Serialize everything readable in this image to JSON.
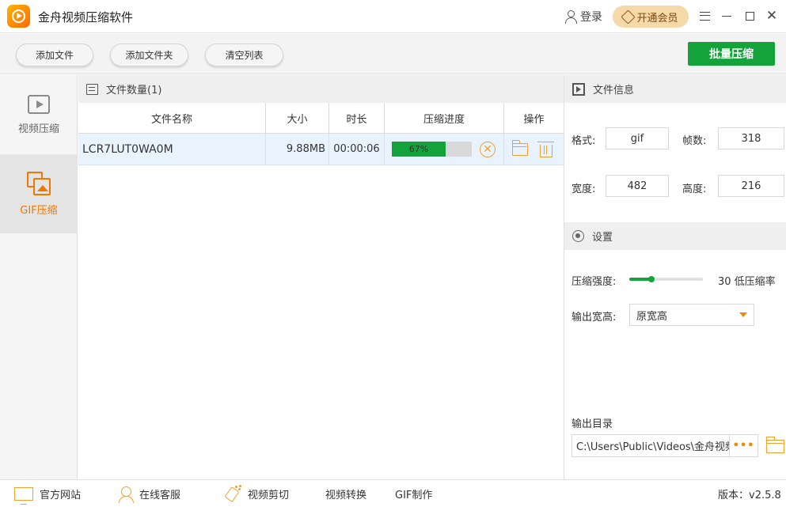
{
  "app": {
    "title": "金舟视频压缩软件"
  },
  "titlebar": {
    "login_label": "登录",
    "vip_label": "开通会员"
  },
  "toolbar": {
    "add_file": "添加文件",
    "add_folder": "添加文件夹",
    "clear_list": "清空列表",
    "batch_compress": "批量压缩"
  },
  "nav": {
    "items": [
      {
        "label": "视频压缩",
        "icon": "video-play-icon",
        "active": false
      },
      {
        "label": "GIF压缩",
        "icon": "gif-image-icon",
        "active": true
      }
    ],
    "active_color": "#f07800"
  },
  "file_list": {
    "count_label": "文件数量(1)",
    "columns": [
      "文件名称",
      "大小",
      "时长",
      "压缩进度",
      "操作"
    ],
    "rows": [
      {
        "name": "LCR7LUT0WA0M",
        "size": "9.88MB",
        "duration": "00:00:06",
        "progress": 67,
        "progress_label": "67%"
      }
    ]
  },
  "file_info": {
    "heading": "文件信息",
    "format_label": "格式:",
    "format_value": "gif",
    "frames_label": "帧数:",
    "frames_value": "318",
    "width_label": "宽度:",
    "width_value": "482",
    "height_label": "高度:",
    "height_value": "216"
  },
  "settings": {
    "heading": "设置",
    "strength_label": "压缩强度:",
    "strength_value": 30,
    "strength_display": "30 低压缩率",
    "output_size_label": "输出宽高:",
    "output_size_value": "原宽高",
    "output_dir_label": "输出目录",
    "output_dir_value": "C:\\Users\\Public\\Videos\\金舟视频压缩软件",
    "more_label": "•••"
  },
  "statusbar": {
    "website": "官方网站",
    "service": "在线客服",
    "video_edit": "视频剪切",
    "video_convert": "视频转换",
    "gif_make": "GIF制作",
    "version": "版本：v2.5.8"
  },
  "colors": {
    "accent_green": "#14a33a",
    "accent_orange": "#f0a030",
    "vip_bg": "#f6d9a8"
  }
}
